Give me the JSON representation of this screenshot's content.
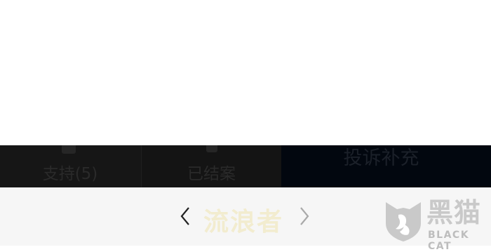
{
  "actions": {
    "support_label": "支持(5)",
    "closed_label": "已结案",
    "complaint_label": "投诉补充"
  },
  "pager": {
    "prev_icon": "chevron-left-icon",
    "next_icon": "chevron-right-icon",
    "watermark": "流浪者"
  },
  "logo": {
    "cn": "黑猫",
    "en": "BLACK CAT",
    "icon": "black-cat-shield-icon"
  }
}
